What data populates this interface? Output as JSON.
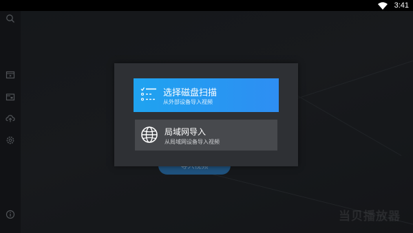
{
  "status_bar": {
    "time": "3:41",
    "wifi_icon": "wifi-icon"
  },
  "sidebar": {
    "icons": [
      "search-icon",
      "video-library-icon",
      "folder-icon",
      "cloud-upload-icon",
      "settings-icon",
      "info-icon"
    ]
  },
  "background": {
    "button_label": "导入视频",
    "watermark": "当贝播放器"
  },
  "dialog": {
    "options": [
      {
        "title": "选择磁盘扫描",
        "subtitle": "从外部设备导入视频",
        "icon": "checklist-icon",
        "selected": true,
        "color": "#1fa3f0"
      },
      {
        "title": "局域网导入",
        "subtitle": "从局域网设备导入视频",
        "icon": "globe-icon",
        "selected": false,
        "color": "#47494d"
      }
    ]
  }
}
